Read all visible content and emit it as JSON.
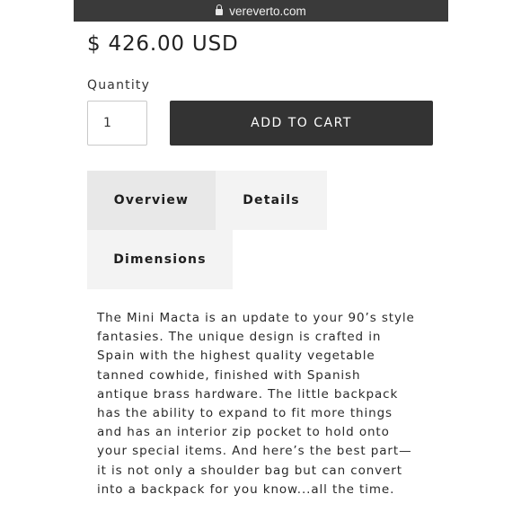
{
  "browser": {
    "url": "vereverto.com",
    "lock_icon": "lock-icon"
  },
  "product": {
    "price": "$ 426.00 USD",
    "quantity_label": "Quantity",
    "quantity_value": "1",
    "add_to_cart_label": "ADD TO CART"
  },
  "tabs": [
    {
      "label": "Overview",
      "active": true
    },
    {
      "label": "Details",
      "active": false
    },
    {
      "label": "Dimensions",
      "active": false
    }
  ],
  "description": {
    "lines": [
      "The Mini Macta is an update to your 90’s style",
      "fantasies. The unique design is crafted in",
      "Spain with the highest quality vegetable",
      "tanned cowhide, finished with Spanish",
      "antique brass hardware. The little backpack",
      "has the ability to expand to fit more things",
      "and has an interior zip pocket to hold onto",
      "your special items. And here’s the best part—",
      "it is not only a shoulder bag but can convert",
      "into a backpack for you know...all the time."
    ]
  },
  "colors": {
    "url_bar": "#3a3a3a",
    "button": "#333333",
    "tab_active": "#e8e8e8",
    "tab_inactive": "#f3f3f3"
  }
}
